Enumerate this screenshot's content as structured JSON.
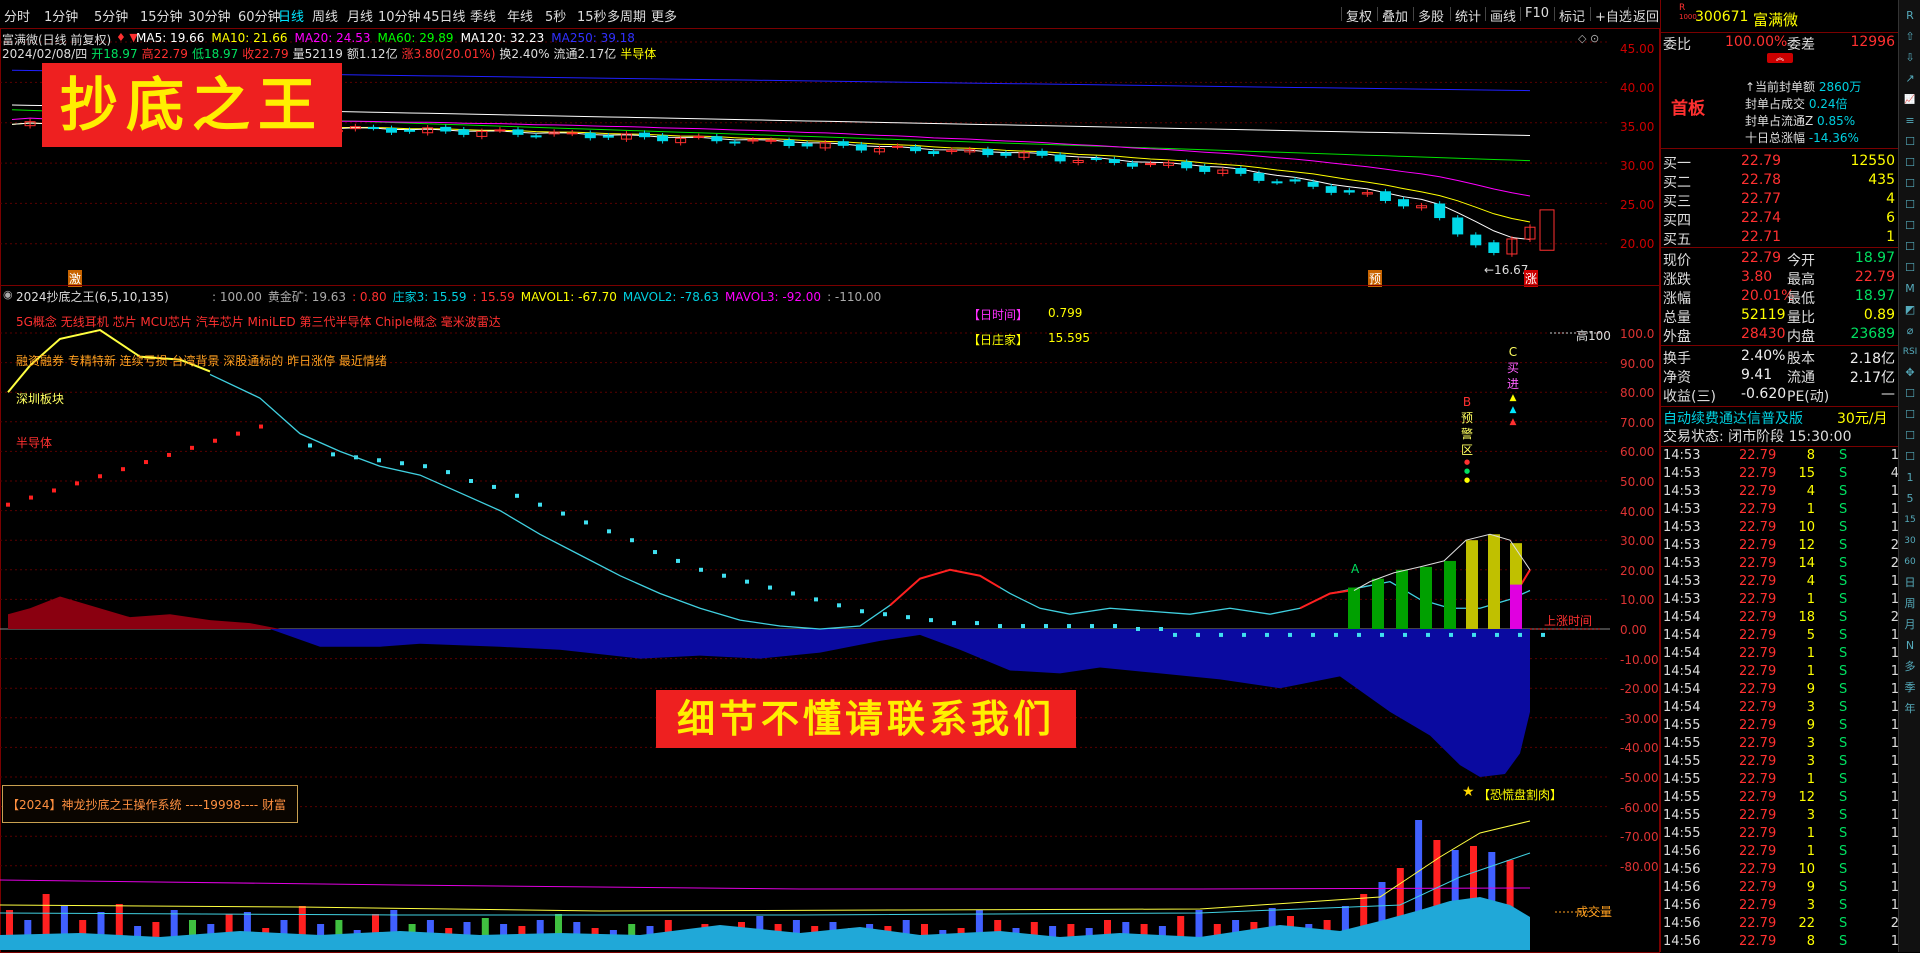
{
  "toolbar": {
    "periods": [
      "分时",
      "1分钟",
      "5分钟",
      "15分钟",
      "30分钟",
      "60分钟",
      "日线",
      "周线",
      "月线",
      "10分钟",
      "45日线",
      "季线",
      "年线",
      "5秒",
      "15秒",
      "多周期",
      "更多"
    ],
    "active_index": 6,
    "right_buttons": [
      "复权",
      "叠加",
      "多股",
      "统计",
      "画线",
      "F10",
      "标记",
      "+自选",
      "返回"
    ]
  },
  "main_chart": {
    "title": "富满微(日线 前复权)",
    "ma_labels": [
      {
        "text": "MA5: 19.66",
        "color": "#ffffff"
      },
      {
        "text": "MA10: 21.66",
        "color": "#ffff00"
      },
      {
        "text": "MA20: 24.53",
        "color": "#ff00ff"
      },
      {
        "text": "MA60: 29.89",
        "color": "#00ff00"
      },
      {
        "text": "MA120: 32.23",
        "color": "#ffffff"
      },
      {
        "text": "MA250: 39.18",
        "color": "#3030ff"
      }
    ],
    "info_line": [
      {
        "text": "2024/02/08/四",
        "color": "#dddddd"
      },
      {
        "text": "开18.97",
        "color": "#00e060"
      },
      {
        "text": "高22.79",
        "color": "#ff3030"
      },
      {
        "text": "低18.97",
        "color": "#00e060"
      },
      {
        "text": "收22.79",
        "color": "#ff3030"
      },
      {
        "text": "量52119",
        "color": "#dddddd"
      },
      {
        "text": "额1.12亿",
        "color": "#dddddd"
      },
      {
        "text": "涨3.80(20.01%)",
        "color": "#ff3030"
      },
      {
        "text": "换2.40%",
        "color": "#dddddd"
      },
      {
        "text": "流通2.17亿",
        "color": "#dddddd"
      },
      {
        "text": "半导体",
        "color": "#ffff00"
      }
    ],
    "y_ticks": [
      "45.00",
      "40.00",
      "35.00",
      "30.00",
      "25.00",
      "20.00"
    ],
    "low_label": "←16.67",
    "tag_left": "激",
    "tag_pre": "预",
    "tag_up": "涨"
  },
  "indicator": {
    "title": "2024抄底之王(6,5,10,135)",
    "params": [
      {
        "text": ": 100.00",
        "color": "#aaaaaa"
      },
      {
        "text": "黄金矿: 19.63",
        "color": "#aaaaaa"
      },
      {
        "text": ": 0.80",
        "color": "#ff3030"
      },
      {
        "text": "庄家3: 15.59",
        "color": "#00d0e0"
      },
      {
        "text": ": 15.59",
        "color": "#ff3030"
      },
      {
        "text": "MAVOL1: -67.70",
        "color": "#ffff00"
      },
      {
        "text": "MAVOL2: -78.63",
        "color": "#00d0e0"
      },
      {
        "text": "MAVOL3: -92.00",
        "color": "#ff00ff"
      },
      {
        "text": ": -110.00",
        "color": "#aaaaaa"
      }
    ],
    "concepts": "5G概念 无线耳机 芯片 MCU芯片 汽车芯片 MiniLED 第三代半导体 Chiple概念 毫米波雷达",
    "tags_line": "融资融券 专精特新 连续亏损 台湾背景 深股通标的 昨日涨停 最近情绪",
    "sector1": "深圳板块",
    "sector2": "半导体",
    "day_time_label": "【日时间】",
    "day_time_value": "0.799",
    "day_zhuang_label": "【日庄家】",
    "day_zhuang_value": "15.595",
    "high100": "高100",
    "up_time": "上涨时间",
    "cheng_jiao": "成交量",
    "panic": "【恐慌盘割肉】",
    "system_box": "【2024】神龙抄底之王操作系统 ----19998---- 财富",
    "b_label": [
      "B",
      "预",
      "警",
      "区"
    ],
    "c_label": [
      "C",
      "买",
      "进"
    ],
    "a_label": "A",
    "y_ticks": [
      "100.0",
      "90.00",
      "80.00",
      "70.00",
      "60.00",
      "50.00",
      "40.00",
      "30.00",
      "20.00",
      "10.00",
      "0.00",
      "-10.00",
      "-20.00",
      "-30.00",
      "-40.00",
      "-50.00",
      "-60.00",
      "-70.00",
      "-80.00"
    ]
  },
  "banners": {
    "top": "抄底之王",
    "mid": "细节不懂请联系我们"
  },
  "quote": {
    "code": "300671",
    "name": "富满微",
    "weibi_label": "委比",
    "weibi": "100.00%",
    "weicha_label": "委差",
    "weicha": "12996",
    "first_board": "首板",
    "seal_lines": [
      {
        "label": "↑当前封单额",
        "value": "2860万"
      },
      {
        "label": "封单占成交",
        "value": "0.24倍"
      },
      {
        "label": "封单占流通Z",
        "value": "0.85%"
      },
      {
        "label": "十日总涨幅",
        "value": "-14.36%"
      }
    ],
    "bids": [
      {
        "label": "买一",
        "price": "22.79",
        "vol": "12550"
      },
      {
        "label": "买二",
        "price": "22.78",
        "vol": "435"
      },
      {
        "label": "买三",
        "price": "22.77",
        "vol": "4"
      },
      {
        "label": "买四",
        "price": "22.74",
        "vol": "6"
      },
      {
        "label": "买五",
        "price": "22.71",
        "vol": "1"
      }
    ],
    "stats": [
      {
        "l1": "现价",
        "v1": "22.79",
        "c1": "red",
        "l2": "今开",
        "v2": "18.97",
        "c2": "grn"
      },
      {
        "l1": "涨跌",
        "v1": "3.80",
        "c1": "red",
        "l2": "最高",
        "v2": "22.79",
        "c2": "red"
      },
      {
        "l1": "涨幅",
        "v1": "20.01%",
        "c1": "red",
        "l2": "最低",
        "v2": "18.97",
        "c2": "grn"
      },
      {
        "l1": "总量",
        "v1": "52119",
        "c1": "yel",
        "l2": "量比",
        "v2": "0.89",
        "c2": "yel"
      },
      {
        "l1": "外盘",
        "v1": "28430",
        "c1": "red",
        "l2": "内盘",
        "v2": "23689",
        "c2": "grn"
      }
    ],
    "stats2": [
      {
        "l1": "换手",
        "v1": "2.40%",
        "l2": "股本",
        "v2": "2.18亿"
      },
      {
        "l1": "净资",
        "v1": "9.41",
        "l2": "流通",
        "v2": "2.17亿"
      },
      {
        "l1": "收益(三)",
        "v1": "-0.620",
        "l2": "PE(动)",
        "v2": "—"
      }
    ],
    "ad_left": "自动续费通达信普及版",
    "ad_right": "30元/月",
    "trade_state": "交易状态: 闭市阶段 15:30:00",
    "trades": [
      {
        "t": "14:53",
        "p": "22.79",
        "v": "8",
        "s": "S",
        "n": "1"
      },
      {
        "t": "14:53",
        "p": "22.79",
        "v": "15",
        "s": "S",
        "n": "4"
      },
      {
        "t": "14:53",
        "p": "22.79",
        "v": "4",
        "s": "S",
        "n": "1"
      },
      {
        "t": "14:53",
        "p": "22.79",
        "v": "1",
        "s": "S",
        "n": "1"
      },
      {
        "t": "14:53",
        "p": "22.79",
        "v": "10",
        "s": "S",
        "n": "1"
      },
      {
        "t": "14:53",
        "p": "22.79",
        "v": "12",
        "s": "S",
        "n": "2"
      },
      {
        "t": "14:53",
        "p": "22.79",
        "v": "14",
        "s": "S",
        "n": "2"
      },
      {
        "t": "14:53",
        "p": "22.79",
        "v": "4",
        "s": "S",
        "n": "1"
      },
      {
        "t": "14:53",
        "p": "22.79",
        "v": "1",
        "s": "S",
        "n": "1"
      },
      {
        "t": "14:54",
        "p": "22.79",
        "v": "18",
        "s": "S",
        "n": "2"
      },
      {
        "t": "14:54",
        "p": "22.79",
        "v": "5",
        "s": "S",
        "n": "1"
      },
      {
        "t": "14:54",
        "p": "22.79",
        "v": "1",
        "s": "S",
        "n": "1"
      },
      {
        "t": "14:54",
        "p": "22.79",
        "v": "1",
        "s": "S",
        "n": "1"
      },
      {
        "t": "14:54",
        "p": "22.79",
        "v": "9",
        "s": "S",
        "n": "1"
      },
      {
        "t": "14:54",
        "p": "22.79",
        "v": "3",
        "s": "S",
        "n": "1"
      },
      {
        "t": "14:55",
        "p": "22.79",
        "v": "9",
        "s": "S",
        "n": "1"
      },
      {
        "t": "14:55",
        "p": "22.79",
        "v": "3",
        "s": "S",
        "n": "1"
      },
      {
        "t": "14:55",
        "p": "22.79",
        "v": "3",
        "s": "S",
        "n": "1"
      },
      {
        "t": "14:55",
        "p": "22.79",
        "v": "1",
        "s": "S",
        "n": "1"
      },
      {
        "t": "14:55",
        "p": "22.79",
        "v": "12",
        "s": "S",
        "n": "1"
      },
      {
        "t": "14:55",
        "p": "22.79",
        "v": "3",
        "s": "S",
        "n": "1"
      },
      {
        "t": "14:55",
        "p": "22.79",
        "v": "1",
        "s": "S",
        "n": "1"
      },
      {
        "t": "14:56",
        "p": "22.79",
        "v": "1",
        "s": "S",
        "n": "1"
      },
      {
        "t": "14:56",
        "p": "22.79",
        "v": "10",
        "s": "S",
        "n": "1"
      },
      {
        "t": "14:56",
        "p": "22.79",
        "v": "9",
        "s": "S",
        "n": "1"
      },
      {
        "t": "14:56",
        "p": "22.79",
        "v": "3",
        "s": "S",
        "n": "1"
      },
      {
        "t": "14:56",
        "p": "22.79",
        "v": "22",
        "s": "S",
        "n": "2"
      },
      {
        "t": "14:56",
        "p": "22.79",
        "v": "8",
        "s": "S",
        "n": "1"
      }
    ]
  },
  "side_icons": [
    "R",
    "⇧",
    "⇩",
    "↗",
    "📈",
    "≡",
    "☐",
    "☐",
    "☐",
    "☐",
    "☐",
    "☐",
    "☐",
    "M",
    "◩",
    "⌀",
    "RSI",
    "✥",
    "☐",
    "☐",
    "☐",
    "☐",
    "1",
    "5",
    "15",
    "30",
    "60",
    "日",
    "周",
    "月",
    "N",
    "多",
    "季",
    "年"
  ],
  "colors": {
    "up": "#ff3030",
    "down": "#00d8e8",
    "axis": "#7a0000",
    "ma250": "#2020ff"
  }
}
